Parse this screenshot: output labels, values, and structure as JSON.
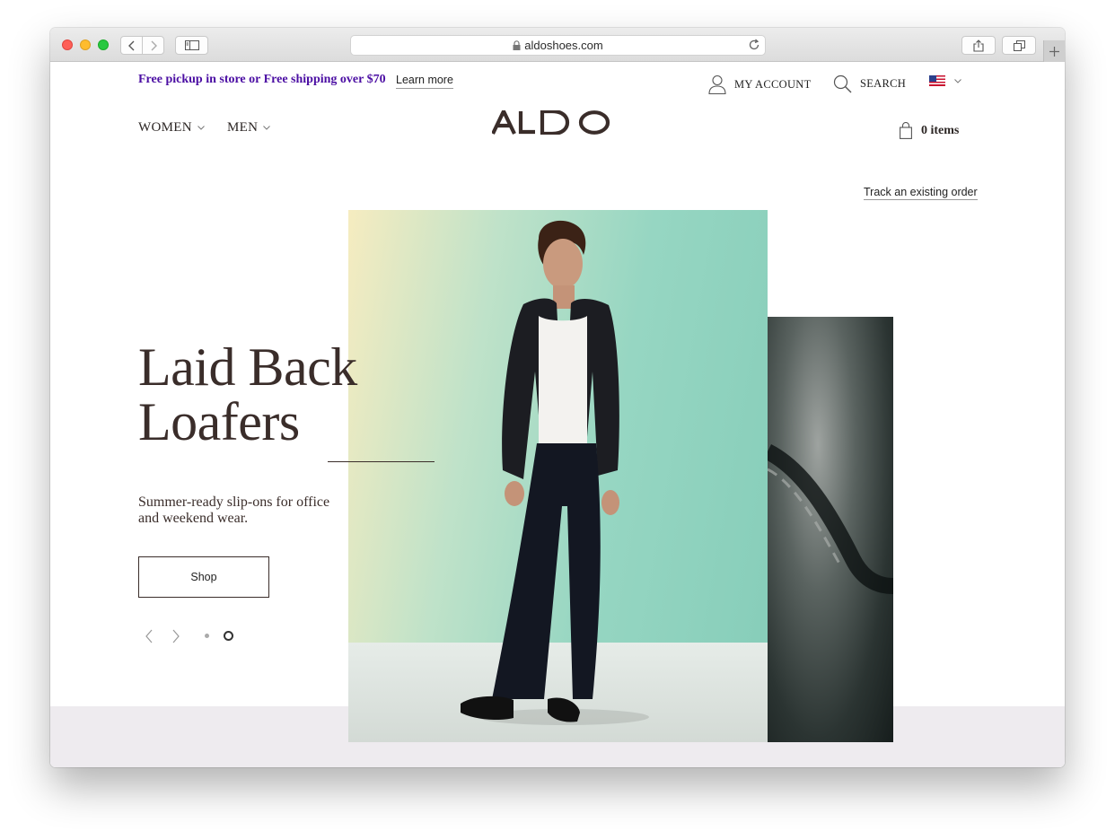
{
  "browser": {
    "url": "aldoshoes.com",
    "icons": [
      "back-icon",
      "forward-icon",
      "sidebar-icon",
      "lock-icon",
      "reload-icon",
      "share-icon",
      "tabs-icon",
      "plus-icon"
    ]
  },
  "header": {
    "promo_text": "Free pickup in store or Free shipping over $70",
    "learn_more": "Learn more",
    "my_account": "MY ACCOUNT",
    "search": "SEARCH",
    "country": "US",
    "nav": {
      "women": "WOMEN",
      "men": "MEN"
    },
    "logo": "ALDO",
    "cart": "0 items",
    "track_order": "Track an existing order"
  },
  "hero": {
    "headline_line1": "Laid Back",
    "headline_line2": "Loafers",
    "subtext": "Summer-ready slip-ons for office and weekend wear.",
    "cta": "Shop",
    "slide_count": 2,
    "active_slide": 2
  },
  "colors": {
    "promo": "#4b0ea3",
    "headline": "#3a2d2a",
    "hero_bg": "#96d6c2",
    "bottom_band": "#eeebef"
  }
}
